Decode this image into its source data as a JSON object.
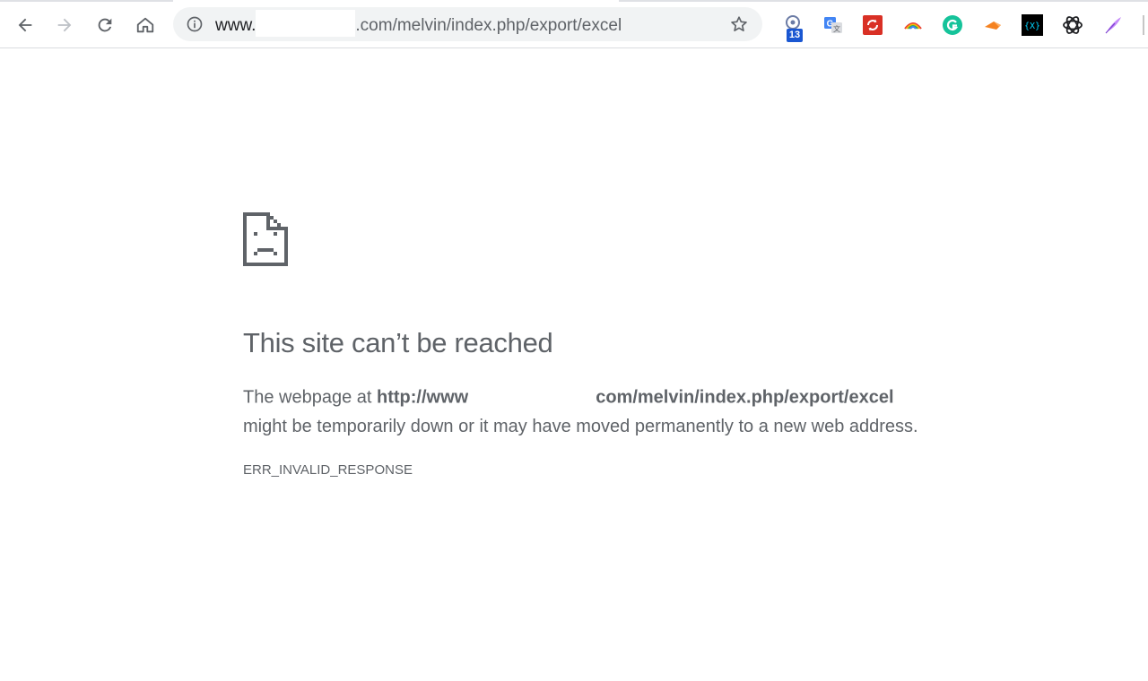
{
  "browser": {
    "omnibox": {
      "url_prefix": "www.",
      "url_path": ".com/melvin/index.php/export/excel",
      "info_icon": "info-icon",
      "bookmark_icon": "star-icon"
    },
    "nav": {
      "back_icon": "back-arrow-icon",
      "forward_icon": "forward-arrow-icon",
      "reload_icon": "reload-icon",
      "home_icon": "home-icon"
    },
    "extensions": [
      {
        "icon": "notification-extension-icon",
        "badge": "13",
        "color": "#1a57d2"
      },
      {
        "icon": "google-translate-icon",
        "color": "#4285f4"
      },
      {
        "icon": "sync-extension-icon",
        "color": "#d93025"
      },
      {
        "icon": "rainbow-arc-extension-icon",
        "color": "#34a853"
      },
      {
        "icon": "grammarly-icon",
        "color": "#15c39a"
      },
      {
        "icon": "orange-shape-extension-icon",
        "color": "#f58220"
      },
      {
        "icon": "json-viewer-icon",
        "color": "#000000"
      },
      {
        "icon": "openai-icon",
        "color": "#202124"
      },
      {
        "icon": "quill-icon",
        "color": "#a142f4"
      }
    ]
  },
  "error_page": {
    "icon": "sad-document-icon",
    "title": "This site can’t be reached",
    "line1_prefix": "The webpage at ",
    "line1_url_start": "http://www",
    "line1_url_end": "com/melvin/index.php/export/excel",
    "line2": "might be temporarily down or it may have moved permanently to a new web address.",
    "error_code": "ERR_INVALID_RESPONSE"
  }
}
